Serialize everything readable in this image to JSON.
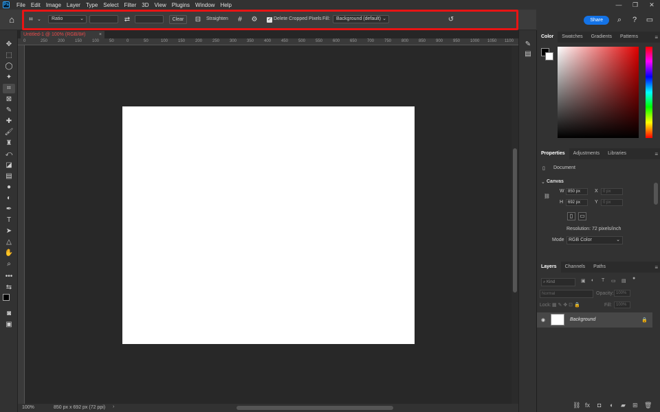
{
  "menubar": {
    "logo": "Ps",
    "items": [
      "File",
      "Edit",
      "Image",
      "Layer",
      "Type",
      "Select",
      "Filter",
      "3D",
      "View",
      "Plugins",
      "Window",
      "Help"
    ],
    "window_controls": [
      "—",
      "❐",
      "✕"
    ]
  },
  "options_bar": {
    "ratio_select": "Ratio",
    "clear_label": "Clear",
    "straighten_label": "Straighten",
    "delete_cropped_label": "Delete Cropped Pixels",
    "delete_cropped_checked": true,
    "fill_label": "Fill:",
    "fill_value": "Background (default)",
    "highlight_color": "#e81414"
  },
  "top_right": {
    "share_label": "Share"
  },
  "document": {
    "tab_title": "Untitled-1 @ 100% (RGB/8#)",
    "zoom": "100%",
    "doc_info": "850 px x 692 px (72 ppi)"
  },
  "ruler": {
    "h_ticks": [
      "0",
      "250",
      "200",
      "150",
      "100",
      "50",
      "0",
      "50",
      "100",
      "150",
      "200",
      "250",
      "300",
      "350",
      "400",
      "450",
      "500",
      "550",
      "600",
      "650",
      "700",
      "750",
      "800",
      "850",
      "900",
      "950",
      "1000",
      "1050",
      "1100"
    ]
  },
  "color_panel": {
    "tabs": [
      "Color",
      "Swatches",
      "Gradients",
      "Patterns"
    ],
    "active": "Color",
    "foreground": "#000000",
    "background": "#ffffff"
  },
  "properties_panel": {
    "tabs": [
      "Properties",
      "Adjustments",
      "Libraries"
    ],
    "doc_label": "Document",
    "canvas_label": "Canvas",
    "w_label": "W",
    "w_value": "850 px",
    "h_label": "H",
    "h_value": "692 px",
    "x_label": "X",
    "x_value": "0 px",
    "y_label": "Y",
    "y_value": "0 px",
    "resolution": "Resolution: 72 pixels/inch",
    "mode_label": "Mode",
    "mode_value": "RGB Color"
  },
  "layers_panel": {
    "tabs": [
      "Layers",
      "Channels",
      "Paths"
    ],
    "kind_placeholder": "Kind",
    "blend_mode": "Normal",
    "opacity_label": "Opacity:",
    "opacity_value": "100%",
    "lock_label": "Lock:",
    "fill_label": "Fill:",
    "fill_value": "100%",
    "layer_name": "Background"
  }
}
